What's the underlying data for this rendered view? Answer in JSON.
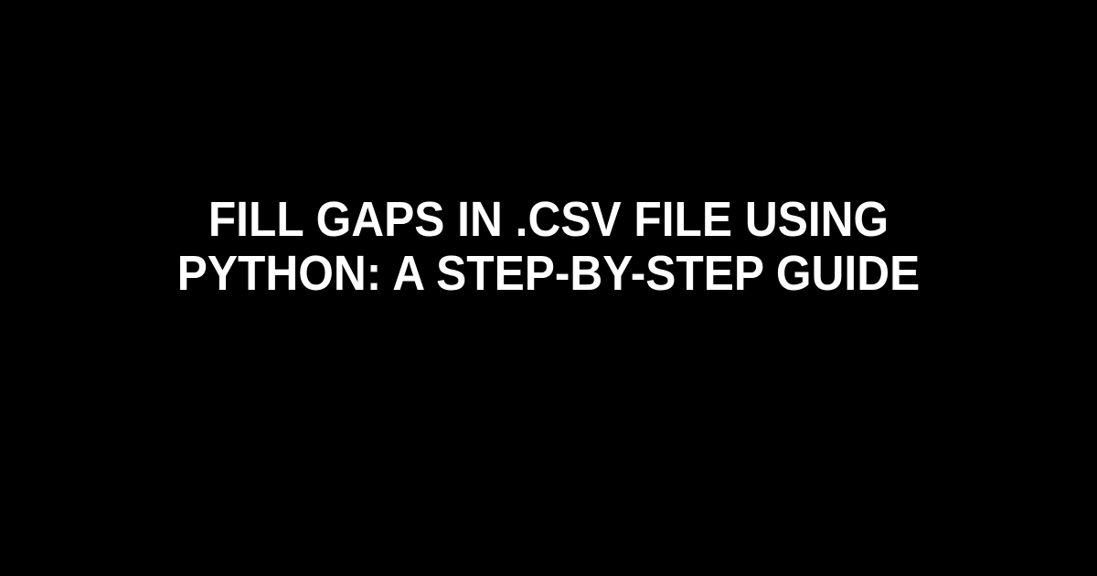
{
  "headline": "Fill gaps in .csv file using Python: A Step-by-Step Guide"
}
